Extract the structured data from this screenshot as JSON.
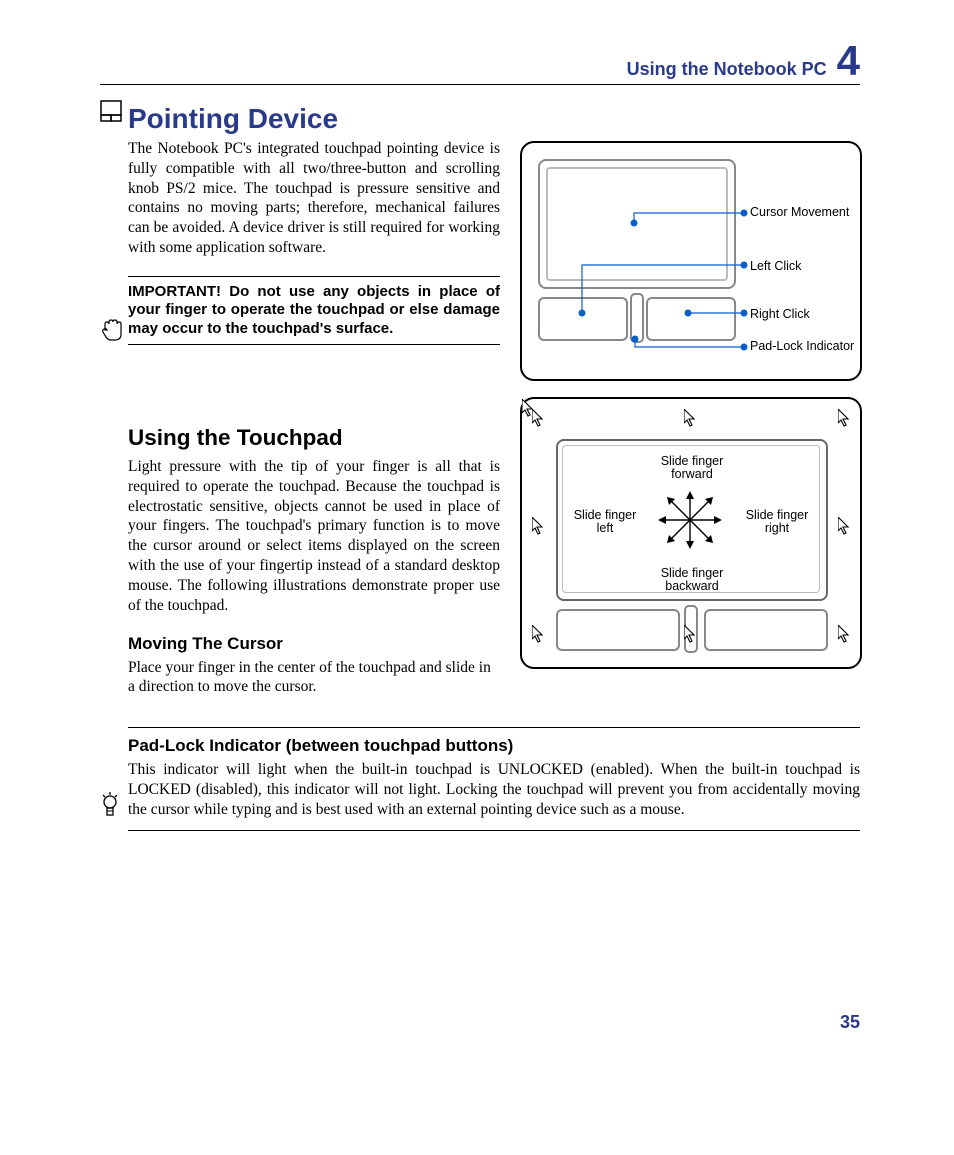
{
  "header": {
    "title": "Using the Notebook PC",
    "chapter": "4"
  },
  "h1": "Pointing Device",
  "intro": "The Notebook PC's integrated touchpad pointing device is fully compatible with all two/three-button and scrolling knob PS/2 mice. The touchpad is pressure sensitive and contains no moving parts; therefore, mechanical failures can be avoided. A device driver is still required for working with some application software.",
  "important": "IMPORTANT! Do not use any objects in place of your finger to operate the touchpad or else damage may occur to the touchpad's surface.",
  "fig1": {
    "l1": "Cursor Movement",
    "l2": "Left Click",
    "l3": "Right Click",
    "l4": "Pad-Lock Indicator"
  },
  "h2": "Using the Touchpad",
  "body2": "Light pressure with the tip of your finger is all that is required to operate the touchpad. Because the touchpad is electrostatic sensitive, objects cannot be used in place of your fingers. The touchpad's primary function is to move the cursor around or select items displayed on the screen with the use of your fingertip instead of a standard desktop mouse. The following illustrations demonstrate proper use of the touchpad.",
  "h3a": "Moving The Cursor",
  "body3": "Place your finger in the center of the touchpad and slide in a direction to move the cursor.",
  "fig2": {
    "up": "Slide finger forward",
    "down": "Slide finger backward",
    "left": "Slide finger left",
    "right": "Slide finger right"
  },
  "h3b": "Pad-Lock Indicator (between touchpad buttons)",
  "body4": "This indicator will light when the built-in touchpad is UNLOCKED (enabled). When the built-in touchpad is LOCKED (disabled), this indicator will not light. Locking the touchpad will prevent you from accidentally moving the cursor while typing and is best used with an external pointing device such as a mouse.",
  "pagenum": "35"
}
